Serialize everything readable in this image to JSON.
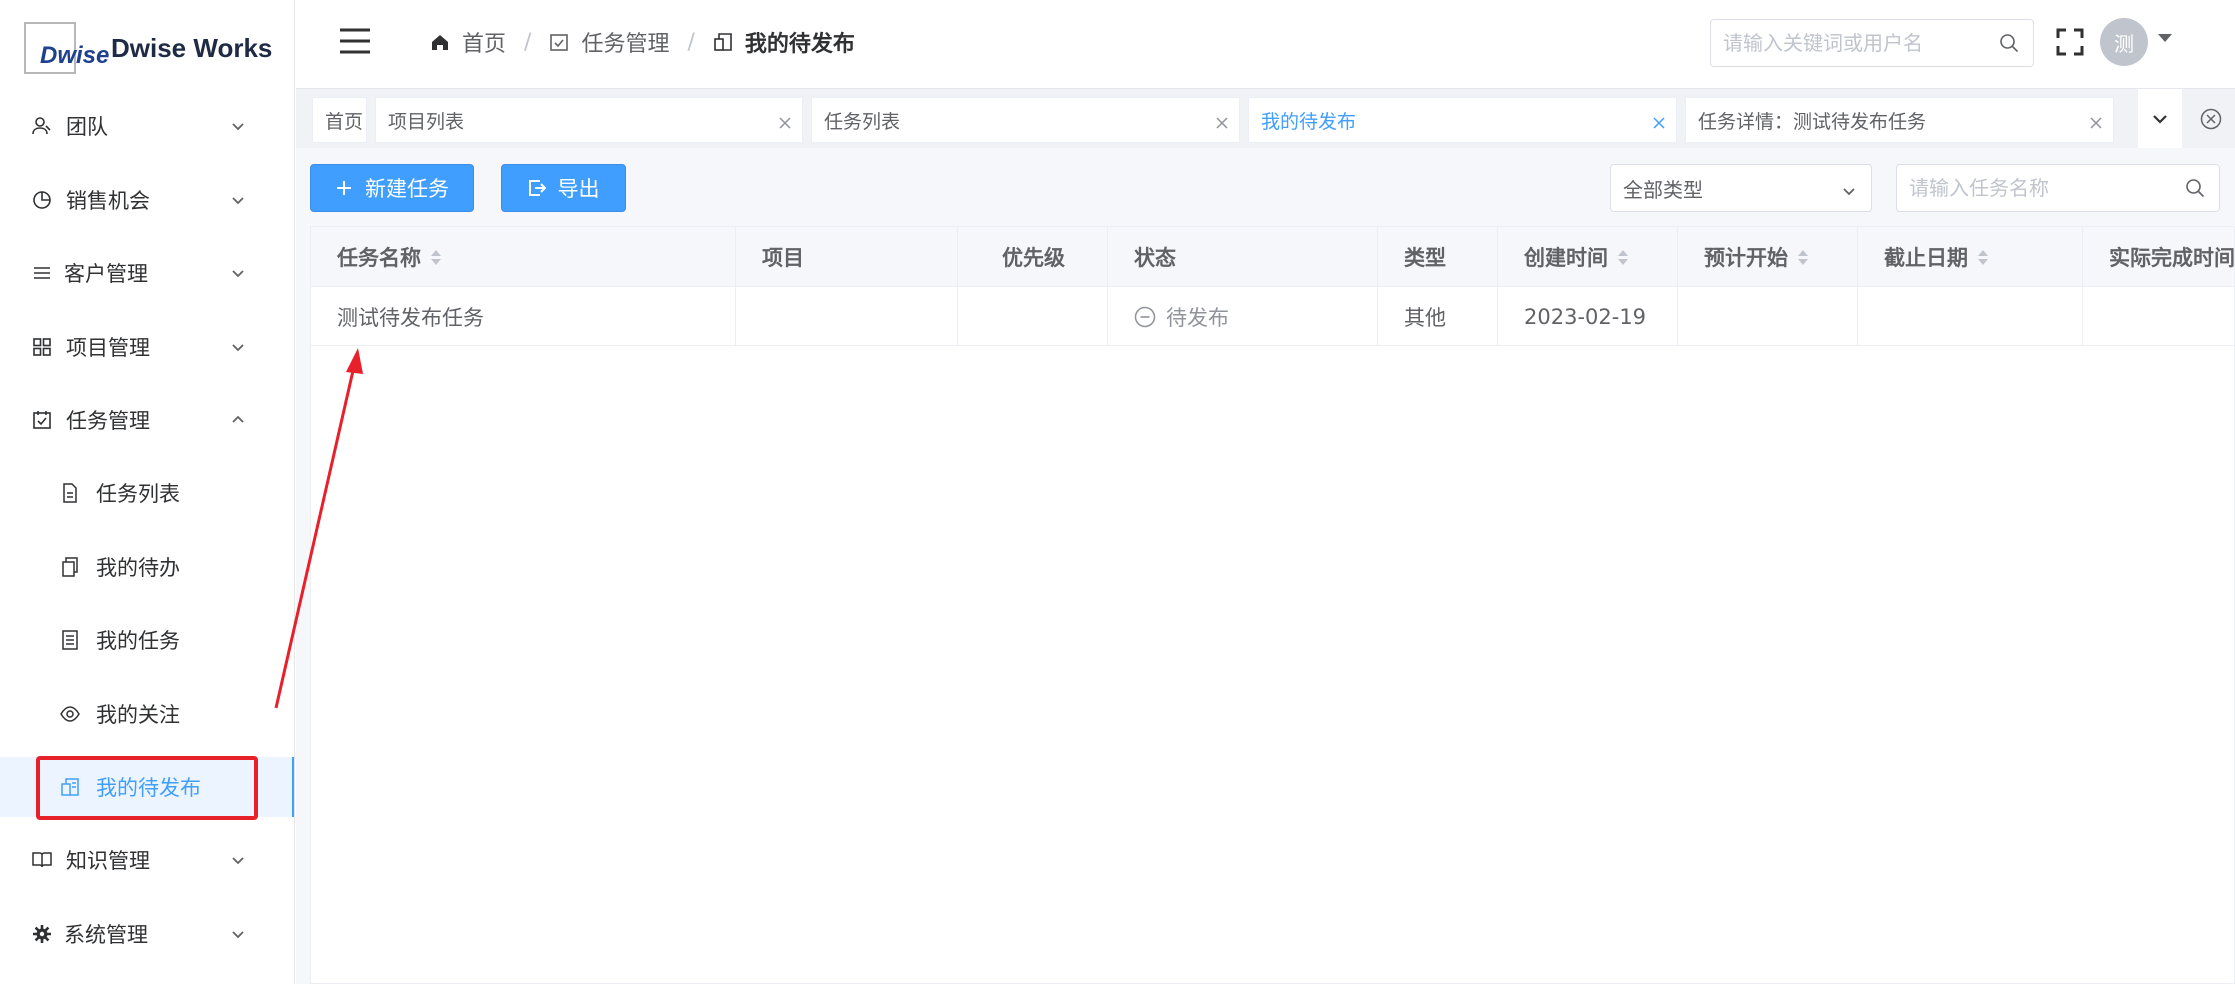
{
  "app": {
    "logo_mark": "Dwise",
    "logo_text": "Dwise Works"
  },
  "sidebar": {
    "items": [
      {
        "label": "团队",
        "icon": "team-icon",
        "expanded": false
      },
      {
        "label": "销售机会",
        "icon": "pie-chart-icon",
        "expanded": false
      },
      {
        "label": "客户管理",
        "icon": "list-icon",
        "expanded": false
      },
      {
        "label": "项目管理",
        "icon": "grid-icon",
        "expanded": false
      },
      {
        "label": "任务管理",
        "icon": "checkbox-icon",
        "expanded": true
      },
      {
        "label": "知识管理",
        "icon": "book-icon",
        "expanded": false
      },
      {
        "label": "系统管理",
        "icon": "gear-icon",
        "expanded": false
      }
    ],
    "sub_items": [
      {
        "label": "任务列表",
        "icon": "document-icon"
      },
      {
        "label": "我的待办",
        "icon": "copy-icon"
      },
      {
        "label": "我的任务",
        "icon": "notebook-icon"
      },
      {
        "label": "我的关注",
        "icon": "eye-icon"
      },
      {
        "label": "我的待发布",
        "icon": "publish-icon",
        "active": true
      }
    ]
  },
  "header": {
    "breadcrumb": [
      "首页",
      "任务管理",
      "我的待发布"
    ],
    "search_placeholder": "请输入关键词或用户名",
    "avatar_text": "测"
  },
  "tags": [
    {
      "label": "首页",
      "closable": false
    },
    {
      "label": "项目列表",
      "closable": true
    },
    {
      "label": "任务列表",
      "closable": true
    },
    {
      "label": "我的待发布",
      "closable": true,
      "active": true
    },
    {
      "label": "任务详情：测试待发布任务",
      "closable": true
    }
  ],
  "toolbar": {
    "new_label": "新建任务",
    "export_label": "导出",
    "type_select": "全部类型",
    "search_placeholder": "请输入任务名称"
  },
  "table": {
    "columns": [
      "任务名称",
      "项目",
      "优先级",
      "状态",
      "类型",
      "创建时间",
      "预计开始",
      "截止日期",
      "实际完成时间"
    ],
    "rows": [
      {
        "name": "测试待发布任务",
        "project": "",
        "priority": "",
        "status": "待发布",
        "type": "其他",
        "created": "2023-02-19",
        "planned_start": "",
        "deadline": "",
        "actual_done": ""
      }
    ]
  },
  "colors": {
    "accent": "#409eff",
    "annotation": "#e8202a"
  }
}
